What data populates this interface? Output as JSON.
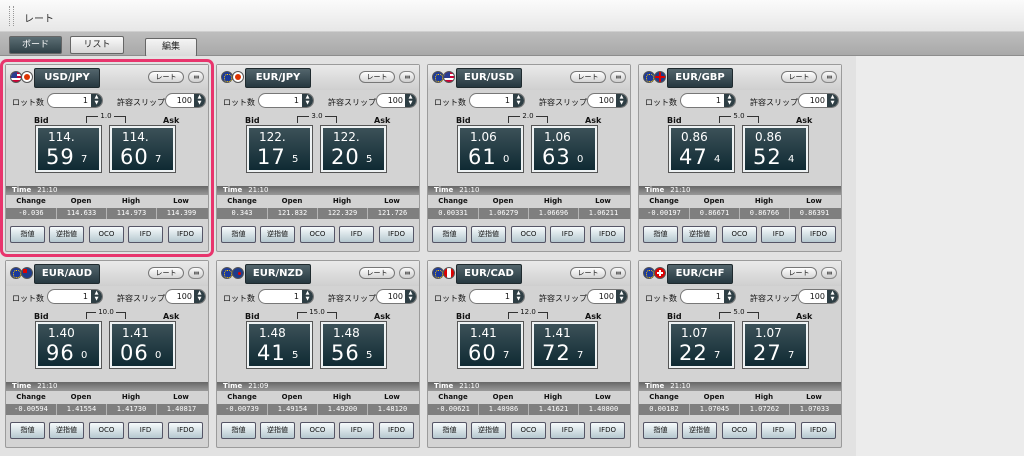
{
  "window": {
    "title": "レート"
  },
  "toolbar": {
    "board_label": "ボード",
    "list_label": "リスト",
    "edit_label": "編集"
  },
  "labels": {
    "rate_button": "レート",
    "toggle": "⏸⏸",
    "lot": "ロット数",
    "slip": "許容スリップ",
    "bid": "Bid",
    "ask": "Ask",
    "time": "Time",
    "change": "Change",
    "open": "Open",
    "high": "High",
    "low": "Low",
    "order_buttons": [
      "指値",
      "逆指値",
      "OCO",
      "IFD",
      "IFDO"
    ]
  },
  "panels": [
    {
      "pair": "USD/JPY",
      "flags": [
        "us",
        "jp"
      ],
      "lot": "1",
      "slip": "100",
      "spread": "1.0",
      "bid": {
        "big": "114.",
        "small": "59",
        "pip": "7"
      },
      "ask": {
        "big": "114.",
        "small": "60",
        "pip": "7"
      },
      "time": "21:10",
      "change": "-0.036",
      "open": "114.633",
      "high": "114.973",
      "low": "114.399",
      "selected": true
    },
    {
      "pair": "EUR/JPY",
      "flags": [
        "eu",
        "jp"
      ],
      "lot": "1",
      "slip": "100",
      "spread": "3.0",
      "bid": {
        "big": "122.",
        "small": "17",
        "pip": "5"
      },
      "ask": {
        "big": "122.",
        "small": "20",
        "pip": "5"
      },
      "time": "21:10",
      "change": "0.343",
      "open": "121.832",
      "high": "122.329",
      "low": "121.726"
    },
    {
      "pair": "EUR/USD",
      "flags": [
        "eu",
        "us"
      ],
      "lot": "1",
      "slip": "100",
      "spread": "2.0",
      "bid": {
        "big": "1.06",
        "small": "61",
        "pip": "0"
      },
      "ask": {
        "big": "1.06",
        "small": "63",
        "pip": "0"
      },
      "time": "21:10",
      "change": "0.00331",
      "open": "1.06279",
      "high": "1.06696",
      "low": "1.06211"
    },
    {
      "pair": "EUR/GBP",
      "flags": [
        "eu",
        "gb"
      ],
      "lot": "1",
      "slip": "100",
      "spread": "5.0",
      "bid": {
        "big": "0.86",
        "small": "47",
        "pip": "4"
      },
      "ask": {
        "big": "0.86",
        "small": "52",
        "pip": "4"
      },
      "time": "21:10",
      "change": "-0.00197",
      "open": "0.86671",
      "high": "0.86766",
      "low": "0.86391"
    },
    {
      "pair": "EUR/AUD",
      "flags": [
        "eu",
        "au"
      ],
      "lot": "1",
      "slip": "100",
      "spread": "10.0",
      "bid": {
        "big": "1.40",
        "small": "96",
        "pip": "0"
      },
      "ask": {
        "big": "1.41",
        "small": "06",
        "pip": "0"
      },
      "time": "21:10",
      "change": "-0.00594",
      "open": "1.41554",
      "high": "1.41730",
      "low": "1.40817"
    },
    {
      "pair": "EUR/NZD",
      "flags": [
        "eu",
        "nz"
      ],
      "lot": "1",
      "slip": "100",
      "spread": "15.0",
      "bid": {
        "big": "1.48",
        "small": "41",
        "pip": "5"
      },
      "ask": {
        "big": "1.48",
        "small": "56",
        "pip": "5"
      },
      "time": "21:09",
      "change": "-0.00739",
      "open": "1.49154",
      "high": "1.49200",
      "low": "1.48120"
    },
    {
      "pair": "EUR/CAD",
      "flags": [
        "eu",
        "ca"
      ],
      "lot": "1",
      "slip": "100",
      "spread": "12.0",
      "bid": {
        "big": "1.41",
        "small": "60",
        "pip": "7"
      },
      "ask": {
        "big": "1.41",
        "small": "72",
        "pip": "7"
      },
      "time": "21:10",
      "change": "-0.00621",
      "open": "1.40986",
      "high": "1.41621",
      "low": "1.40800"
    },
    {
      "pair": "EUR/CHF",
      "flags": [
        "eu",
        "ch"
      ],
      "lot": "1",
      "slip": "100",
      "spread": "5.0",
      "bid": {
        "big": "1.07",
        "small": "22",
        "pip": "7"
      },
      "ask": {
        "big": "1.07",
        "small": "27",
        "pip": "7"
      },
      "time": "21:10",
      "change": "0.00182",
      "open": "1.07045",
      "high": "1.07262",
      "low": "1.07033"
    }
  ]
}
